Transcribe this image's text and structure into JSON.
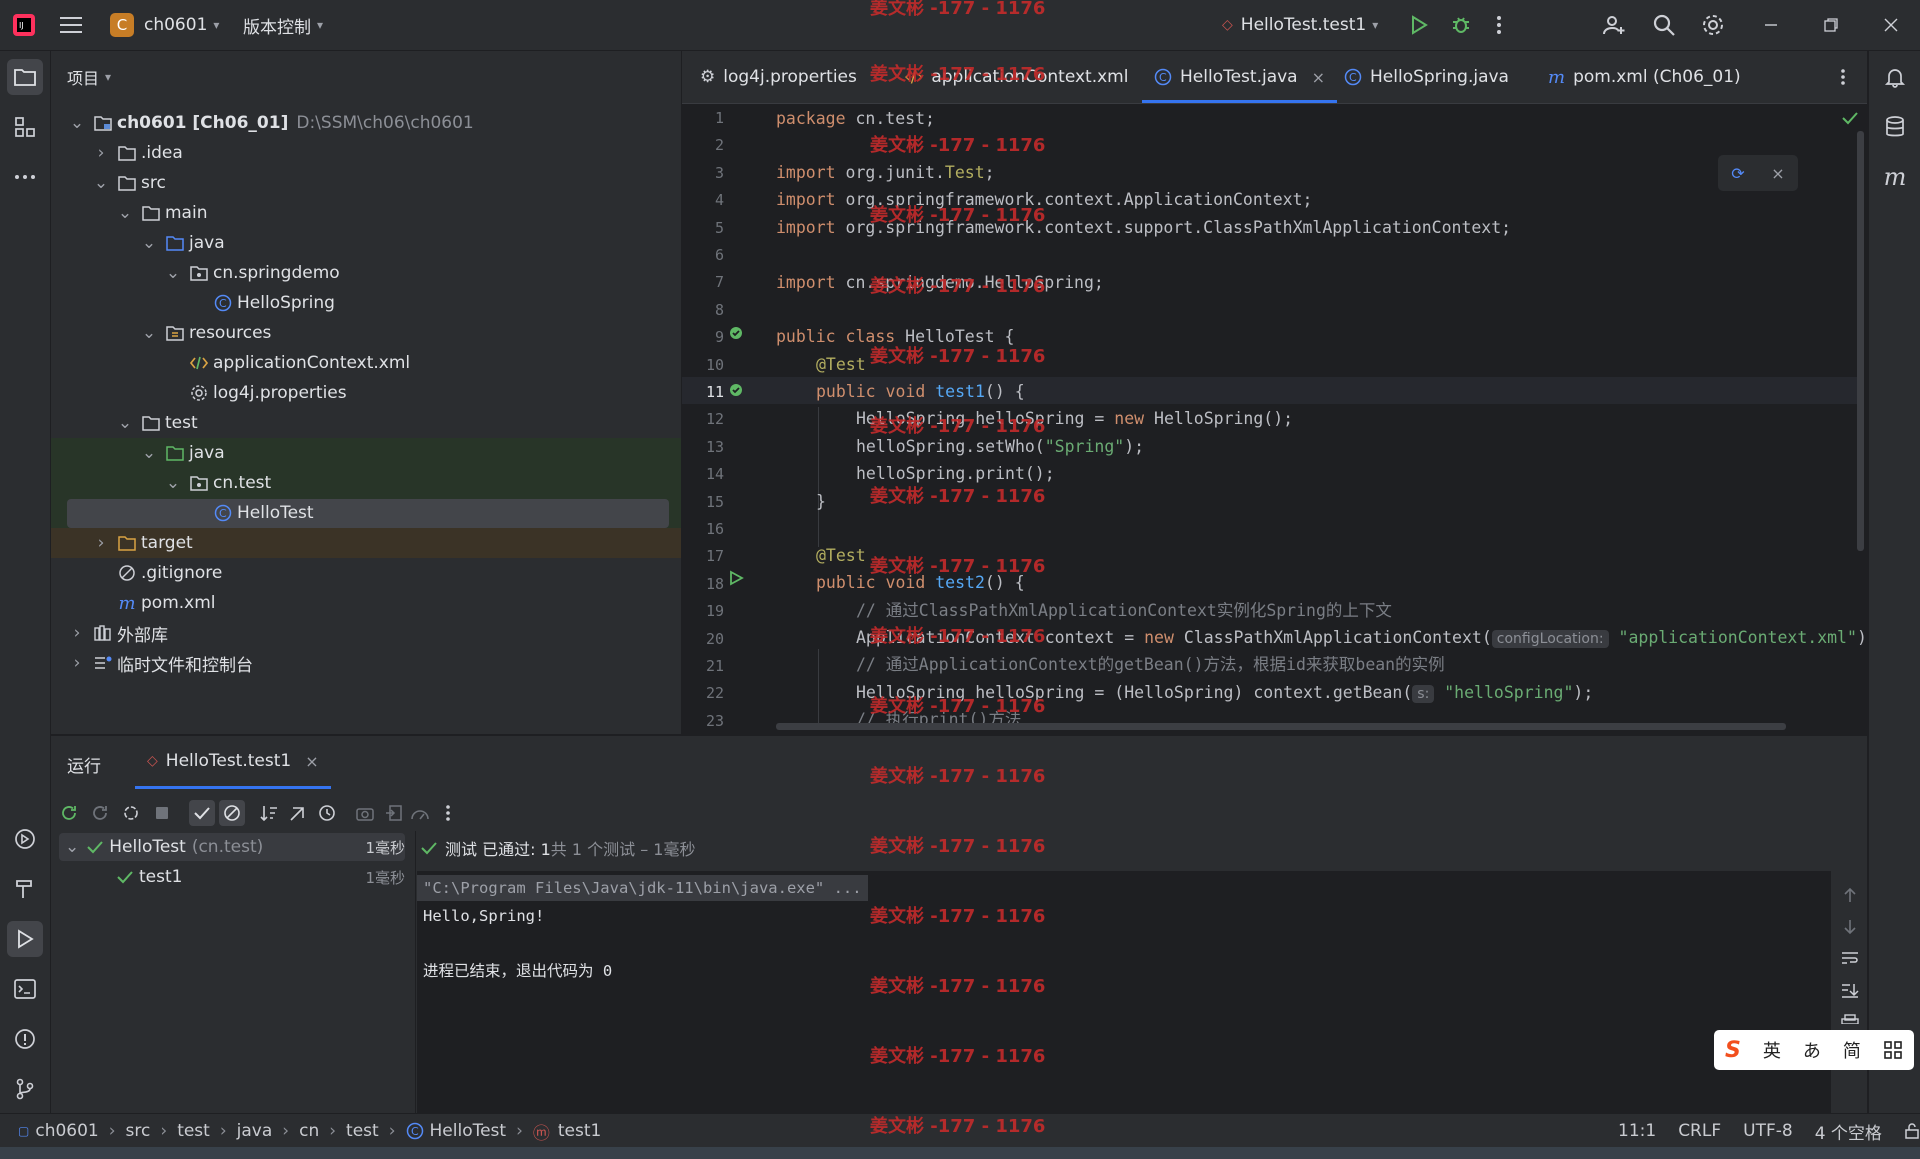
{
  "titlebar": {
    "project_badge": "C",
    "project_name": "ch0601",
    "vcs_label": "版本控制",
    "run_config": "HelloTest.test1"
  },
  "project_panel": {
    "title": "项目",
    "tree": [
      {
        "label": "ch0601 [Ch06_01]",
        "hint": "D:\\SSM\\ch06\\ch0601",
        "icon": "module-folder-icon"
      },
      {
        "label": ".idea",
        "icon": "folder-icon"
      },
      {
        "label": "src",
        "icon": "folder-icon"
      },
      {
        "label": "main",
        "icon": "folder-icon"
      },
      {
        "label": "java",
        "icon": "source-folder-icon"
      },
      {
        "label": "cn.springdemo",
        "icon": "package-icon"
      },
      {
        "label": "HelloSpring",
        "icon": "class-icon"
      },
      {
        "label": "resources",
        "icon": "resources-folder-icon"
      },
      {
        "label": "applicationContext.xml",
        "icon": "xml-file-icon"
      },
      {
        "label": "log4j.properties",
        "icon": "properties-file-icon"
      },
      {
        "label": "test",
        "icon": "folder-icon"
      },
      {
        "label": "java",
        "icon": "test-source-folder-icon"
      },
      {
        "label": "cn.test",
        "icon": "package-icon"
      },
      {
        "label": "HelloTest",
        "icon": "class-icon"
      },
      {
        "label": "target",
        "icon": "excluded-folder-icon"
      },
      {
        "label": ".gitignore",
        "icon": "ignore-file-icon"
      },
      {
        "label": "pom.xml",
        "icon": "maven-file-icon"
      },
      {
        "label": "外部库",
        "icon": "library-icon"
      },
      {
        "label": "临时文件和控制台",
        "icon": "scratches-icon"
      }
    ]
  },
  "editor": {
    "tabs": [
      {
        "label": "log4j.properties",
        "icon": "gear-icon"
      },
      {
        "label": "applicationContext.xml",
        "icon": "xml-file-icon"
      },
      {
        "label": "HelloTest.java",
        "icon": "class-icon",
        "active": true
      },
      {
        "label": "HelloSpring.java",
        "icon": "class-icon"
      },
      {
        "label": "pom.xml (Ch06_01)",
        "icon": "maven-file-icon"
      }
    ],
    "line_numbers": [
      "1",
      "2",
      "3",
      "4",
      "5",
      "6",
      "7",
      "8",
      "9",
      "10",
      "11",
      "12",
      "13",
      "14",
      "15",
      "16",
      "17",
      "18",
      "19",
      "20",
      "21",
      "22",
      "23"
    ],
    "code": {
      "l1a": "package",
      "l1b": " cn.test;",
      "l3a": "import",
      "l3b": " org.junit.",
      "l3c": "Test",
      "l3d": ";",
      "l4a": "import",
      "l4b": " org.springframework.context.ApplicationContext;",
      "l5a": "import",
      "l5b": " org.springframework.context.support.ClassPathXmlApplicationContext;",
      "l7a": "import",
      "l7b": " cn.springdemo.HelloSpring;",
      "l9a": "public class",
      "l9b": " HelloTest {",
      "l10": "@Test",
      "l11a": "public void",
      "l11b": "test1",
      "l11c": "() {",
      "l12a": "HelloSpring helloSpring = ",
      "l12b": "new",
      "l12c": " HelloSpring();",
      "l13a": "helloSpring.setWho(",
      "l13b": "\"Spring\"",
      "l13c": ");",
      "l14": "helloSpring.print();",
      "l15": "}",
      "l17": "@Test",
      "l18a": "public void",
      "l18b": "test2",
      "l18c": "() {",
      "l19": "// 通过ClassPathXmlApplicationContext实例化Spring的上下文",
      "l20a": "ApplicationContext context = ",
      "l20b": "new",
      "l20c": " ClassPathXmlApplicationContext(",
      "l20hint": "configLocation:",
      "l20d": "\"applicationContext.xml\"",
      "l20e": ")",
      "l21": "// 通过ApplicationContext的getBean()方法，根据id来获取bean的实例",
      "l22a": "HelloSpring helloSpring = (HelloSpring) context.getBean(",
      "l22hint": "s:",
      "l22b": "\"helloSpring\"",
      "l22c": ");",
      "l23": "// 执行print()方法"
    }
  },
  "run_panel": {
    "title": "运行",
    "tab_label": "HelloTest.test1",
    "tree": [
      {
        "label": "HelloTest",
        "hint": "(cn.test)",
        "time": "1毫秒"
      },
      {
        "label": "test1",
        "time": "1毫秒"
      }
    ],
    "summary_prefix": "测试 已通过: 1",
    "summary_suffix": "共 1 个测试 – 1毫秒",
    "console_lines": [
      "\"C:\\Program Files\\Java\\jdk-11\\bin\\java.exe\" ...",
      "Hello,Spring!",
      "",
      "进程已结束，退出代码为 0"
    ]
  },
  "statusbar": {
    "breadcrumb": [
      "ch0601",
      "src",
      "test",
      "java",
      "cn",
      "test",
      "HelloTest",
      "test1"
    ],
    "position": "11:1",
    "line_sep": "CRLF",
    "encoding": "UTF-8",
    "indent": "4 个空格"
  },
  "ime": {
    "lang": "英",
    "mode1": "あ",
    "mode2": "简",
    "icon": "grid-icon"
  },
  "watermark": "姜文彬 -177 - 1176"
}
